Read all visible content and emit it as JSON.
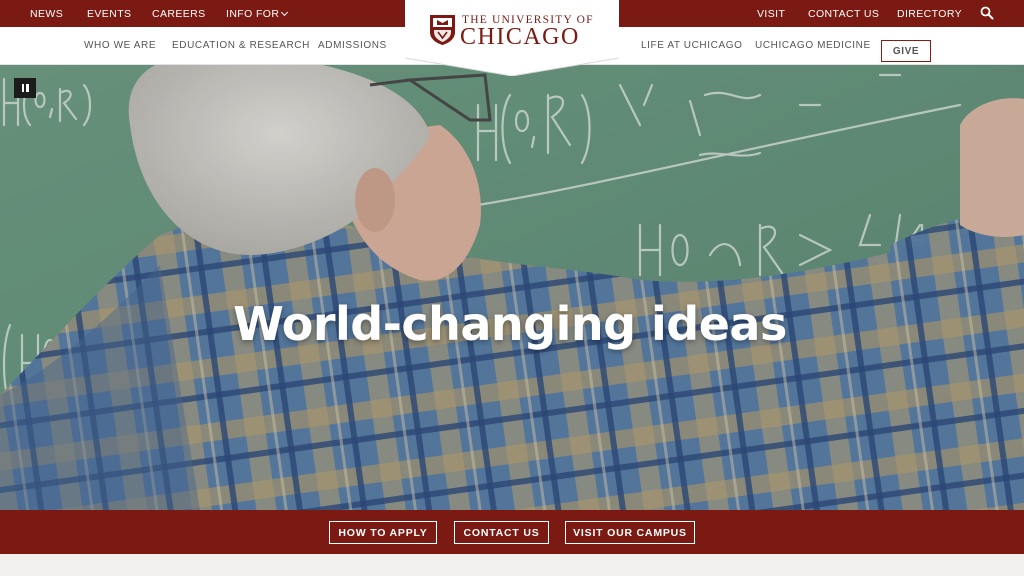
{
  "topbar": {
    "links": [
      "NEWS",
      "EVENTS",
      "CAREERS",
      "INFO FOR",
      "VISIT",
      "CONTACT US",
      "DIRECTORY"
    ],
    "search_icon": "search-icon",
    "info_for_chevron": "chevron-down-icon"
  },
  "logo": {
    "line1": "THE UNIVERSITY OF",
    "line2": "CHICAGO"
  },
  "subnav": {
    "links": [
      "WHO WE ARE",
      "EDUCATION & RESEARCH",
      "ADMISSIONS",
      "LIFE AT UCHICAGO",
      "UCHICAGO MEDICINE"
    ],
    "give_label": "GIVE"
  },
  "hero": {
    "title": "World-changing ideas",
    "pause_icon": "pause-icon"
  },
  "cta": {
    "buttons": [
      "HOW TO APPLY",
      "CONTACT US",
      "VISIT OUR CAMPUS"
    ]
  },
  "colors": {
    "maroon": "#7a1a12",
    "chalkboard": "#6e9a83",
    "white": "#ffffff"
  }
}
